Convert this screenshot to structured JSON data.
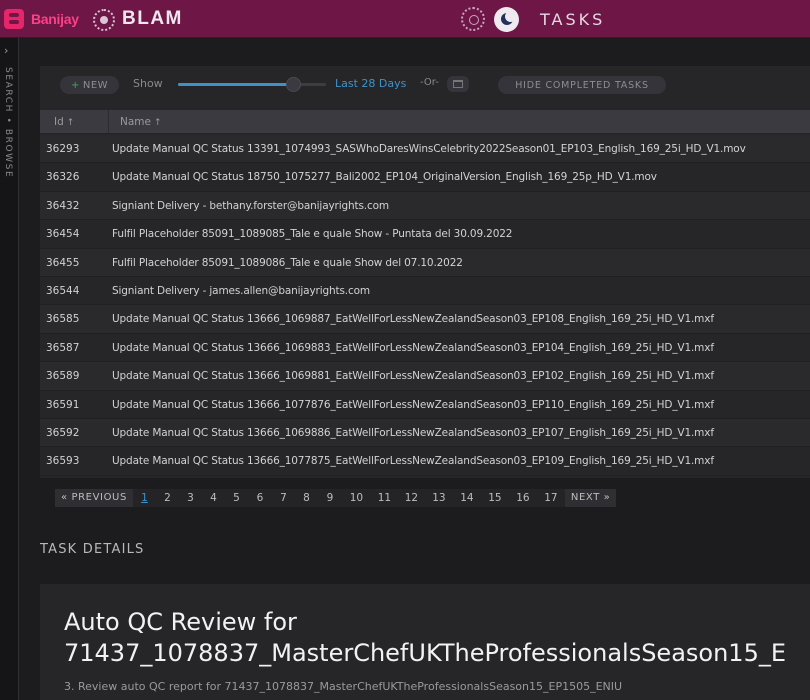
{
  "header": {
    "brand": "Banijay",
    "app_name": "BLAM",
    "page_title": "TASKS",
    "icons": [
      "banijay-logo-icon",
      "blam-logo-icon",
      "gear-icon",
      "moon-icon"
    ]
  },
  "side_rail": {
    "chevron": "›",
    "label": "SEARCH • BROWSE"
  },
  "toolbar": {
    "new_label": "NEW",
    "new_icon": "+",
    "show_label": "Show",
    "range_value": "Last 28 Days",
    "range_fraction": 0.78,
    "or_label": "-Or-",
    "hide_completed_label": "HIDE COMPLETED TASKS"
  },
  "table": {
    "columns": [
      {
        "label": "Id",
        "sort": "↑"
      },
      {
        "label": "Name",
        "sort": "↑"
      }
    ],
    "rows": [
      {
        "id": "36293",
        "name": "Update Manual QC Status 13391_1074993_SASWhoDaresWinsCelebrity2022Season01_EP103_English_169_25i_HD_V1.mov"
      },
      {
        "id": "36326",
        "name": "Update Manual QC Status 18750_1075277_Bali2002_EP104_OriginalVersion_English_169_25p_HD_V1.mov"
      },
      {
        "id": "36432",
        "name": "Signiant Delivery - bethany.forster@banijayrights.com"
      },
      {
        "id": "36454",
        "name": "Fulfil Placeholder 85091_1089085_Tale e quale Show - Puntata del 30.09.2022"
      },
      {
        "id": "36455",
        "name": "Fulfil Placeholder 85091_1089086_Tale e quale Show del 07.10.2022"
      },
      {
        "id": "36544",
        "name": "Signiant Delivery - james.allen@banijayrights.com"
      },
      {
        "id": "36585",
        "name": "Update Manual QC Status 13666_1069887_EatWellForLessNewZealandSeason03_EP108_English_169_25i_HD_V1.mxf"
      },
      {
        "id": "36587",
        "name": "Update Manual QC Status 13666_1069883_EatWellForLessNewZealandSeason03_EP104_English_169_25i_HD_V1.mxf"
      },
      {
        "id": "36589",
        "name": "Update Manual QC Status 13666_1069881_EatWellForLessNewZealandSeason03_EP102_English_169_25i_HD_V1.mxf"
      },
      {
        "id": "36591",
        "name": "Update Manual QC Status 13666_1077876_EatWellForLessNewZealandSeason03_EP110_English_169_25i_HD_V1.mxf"
      },
      {
        "id": "36592",
        "name": "Update Manual QC Status 13666_1069886_EatWellForLessNewZealandSeason03_EP107_English_169_25i_HD_V1.mxf"
      },
      {
        "id": "36593",
        "name": "Update Manual QC Status 13666_1077875_EatWellForLessNewZealandSeason03_EP109_English_169_25i_HD_V1.mxf"
      }
    ]
  },
  "pagination": {
    "previous_label": "« PREVIOUS",
    "next_label": "NEXT »",
    "pages": [
      "1",
      "2",
      "3",
      "4",
      "5",
      "6",
      "7",
      "8",
      "9",
      "10",
      "11",
      "12",
      "13",
      "14",
      "15",
      "16",
      "17"
    ],
    "current": "1"
  },
  "details": {
    "heading": "TASK DETAILS",
    "title_line1": "Auto QC Review for",
    "title_line2": "71437_1078837_MasterChefUKTheProfessionalsSeason15_E",
    "subtitle": "3. Review auto QC report for 71437_1078837_MasterChefUKTheProfessionalsSeason15_EP1505_ENIU"
  },
  "colors": {
    "topbar": "#6e1747",
    "brand_pink": "#e6256b",
    "accent_blue": "#3d93c9",
    "background": "#1c1c1f",
    "panel": "#262629"
  }
}
